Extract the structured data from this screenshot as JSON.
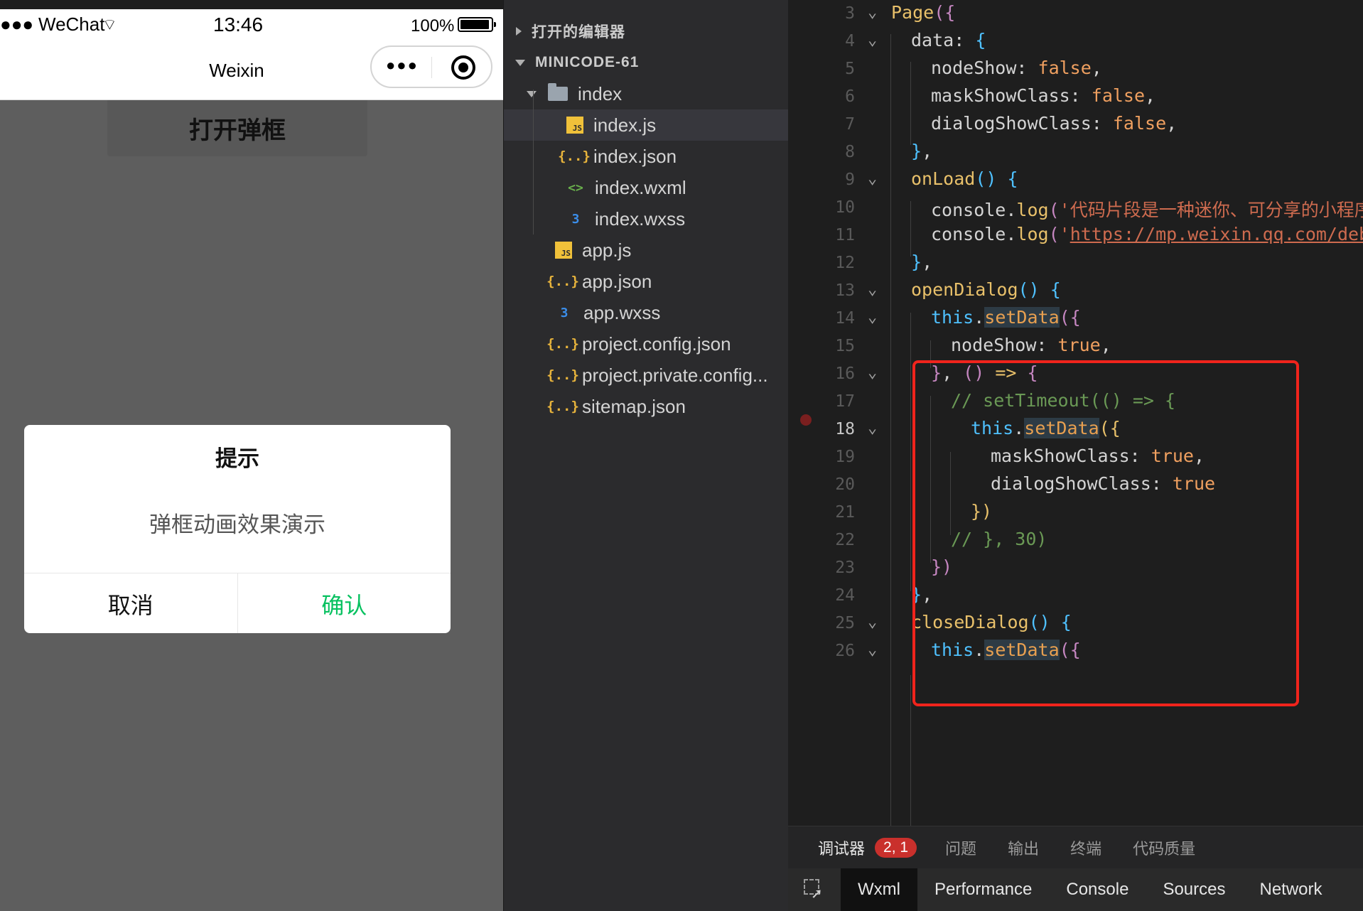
{
  "phone": {
    "status": {
      "carrier": "WeChat",
      "time": "13:46",
      "battery": "100%"
    },
    "nav_title": "Weixin",
    "open_button": "打开弹框",
    "dialog": {
      "title": "提示",
      "content": "弹框动画效果演示",
      "cancel": "取消",
      "confirm": "确认"
    }
  },
  "explorer": {
    "open_editors": "打开的编辑器",
    "project": "MINICODE-61",
    "files": [
      {
        "name": "index",
        "icon": "folder-icon"
      },
      {
        "name": "index.js",
        "icon": "js-file-icon"
      },
      {
        "name": "index.json",
        "icon": "json-file-icon"
      },
      {
        "name": "index.wxml",
        "icon": "wxml-file-icon"
      },
      {
        "name": "index.wxss",
        "icon": "wxss-file-icon"
      },
      {
        "name": "app.js",
        "icon": "js-file-icon"
      },
      {
        "name": "app.json",
        "icon": "json-file-icon"
      },
      {
        "name": "app.wxss",
        "icon": "wxss-file-icon"
      },
      {
        "name": "project.config.json",
        "icon": "json-file-icon"
      },
      {
        "name": "project.private.config...",
        "icon": "json-file-icon"
      },
      {
        "name": "sitemap.json",
        "icon": "json-file-icon"
      }
    ]
  },
  "editor": {
    "current_line": "18",
    "lines": [
      {
        "n": "3",
        "t": "Page({"
      },
      {
        "n": "4",
        "t": "data: {"
      },
      {
        "n": "5",
        "t": "nodeShow: false,"
      },
      {
        "n": "6",
        "t": "maskShowClass: false,"
      },
      {
        "n": "7",
        "t": "dialogShowClass: false,"
      },
      {
        "n": "8",
        "t": "},"
      },
      {
        "n": "9",
        "t": "onLoad() {"
      },
      {
        "n": "10",
        "t": "console.log('代码片段是一种迷你、可分享的小程序或"
      },
      {
        "n": "11",
        "t": "console.log('https://mp.weixin.qq.com/debu"
      },
      {
        "n": "12",
        "t": "},"
      },
      {
        "n": "13",
        "t": "openDialog() {"
      },
      {
        "n": "14",
        "t": "this.setData({"
      },
      {
        "n": "15",
        "t": "nodeShow: true,"
      },
      {
        "n": "16",
        "t": "}, () => {"
      },
      {
        "n": "17",
        "t": "// setTimeout(() => {"
      },
      {
        "n": "18",
        "t": "this.setData({"
      },
      {
        "n": "19",
        "t": "maskShowClass: true,"
      },
      {
        "n": "20",
        "t": "dialogShowClass: true"
      },
      {
        "n": "21",
        "t": "})"
      },
      {
        "n": "22",
        "t": "// }, 30)"
      },
      {
        "n": "23",
        "t": "})"
      },
      {
        "n": "24",
        "t": "},"
      },
      {
        "n": "25",
        "t": "closeDialog() {"
      },
      {
        "n": "26",
        "t": "this.setData({"
      }
    ]
  },
  "panel": {
    "tabs": [
      "调试器",
      "问题",
      "输出",
      "终端",
      "代码质量"
    ],
    "badge": "2, 1",
    "devtools_tabs": [
      "Wxml",
      "Performance",
      "Console",
      "Sources",
      "Network"
    ]
  }
}
